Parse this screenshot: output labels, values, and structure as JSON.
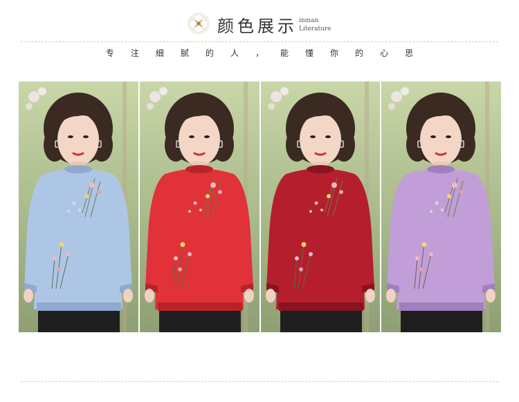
{
  "header": {
    "title": "颜色展示",
    "en_line1": "inman",
    "en_line2": "Literature",
    "slogan_chars": [
      "专",
      "注",
      "细",
      "腻",
      "的",
      "人",
      "，",
      "能",
      "懂",
      "你",
      "的",
      "心",
      "思"
    ]
  },
  "panels": [
    {
      "name": "sweater-light-blue",
      "color": "#aec6e6",
      "shade": "#8fa9cf"
    },
    {
      "name": "sweater-red",
      "color": "#e03238",
      "shade": "#b8232a"
    },
    {
      "name": "sweater-burgundy",
      "color": "#b51e2c",
      "shade": "#8a1320"
    },
    {
      "name": "sweater-lavender",
      "color": "#c29ed8",
      "shade": "#a07fbf"
    }
  ],
  "colors": {
    "divider": "#d9cca6",
    "text": "#333333"
  }
}
